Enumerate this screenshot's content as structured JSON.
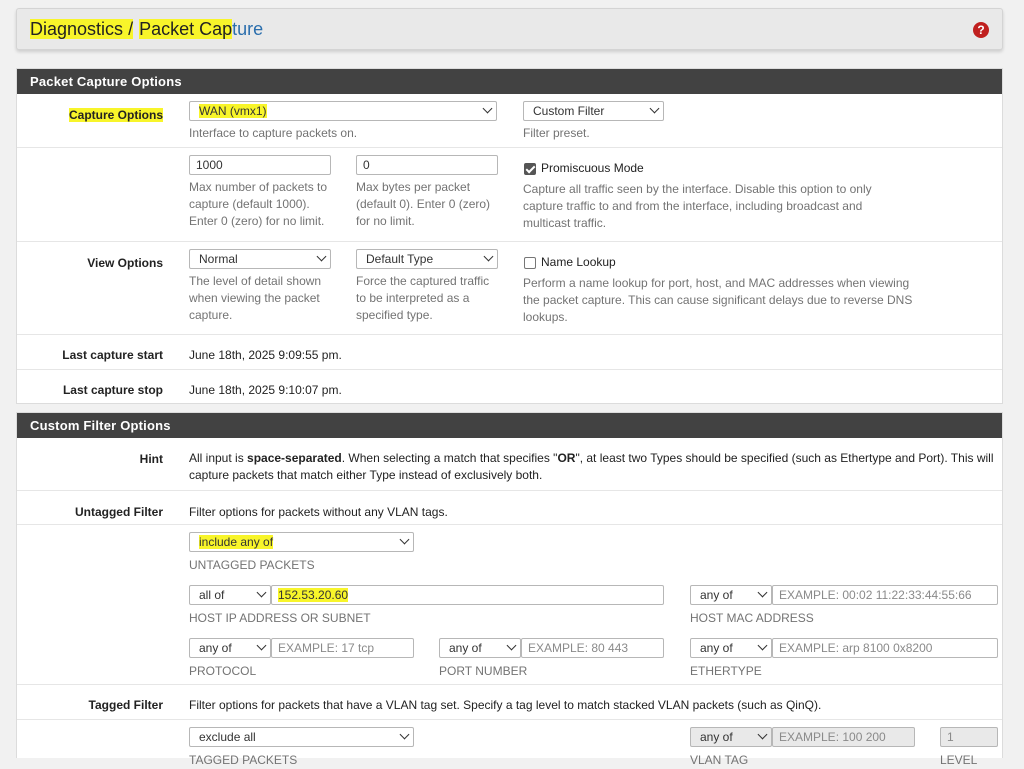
{
  "breadcrumb": {
    "section": "Diagnostics",
    "separator": "/",
    "page_a": "Packet Cap",
    "page_b": "ture"
  },
  "help_icon": "question-circle-icon",
  "colors": {
    "panel_header": "#424242",
    "highlight": "#f8f52a",
    "help_red": "#c0201f",
    "link_blue": "#2a6ead"
  },
  "capture_panel": {
    "title": "Packet Capture Options",
    "capture_options": {
      "label": "Capture Options",
      "interface": "WAN (vmx1)",
      "interface_help": "Interface to capture packets on.",
      "filter": "Custom Filter",
      "filter_help": "Filter preset."
    },
    "limits": {
      "packets": "1000",
      "packets_help": "Max number of packets to capture (default 1000). Enter 0 (zero) for no limit.",
      "bytes": "0",
      "bytes_help": "Max bytes per packet (default 0). Enter 0 (zero) for no limit.",
      "promiscuous_label": "Promiscuous Mode",
      "promiscuous_checked": true,
      "promiscuous_help": "Capture all traffic seen by the interface. Disable this option to only capture traffic to and from the interface, including broadcast and multicast traffic."
    },
    "view_options": {
      "label": "View Options",
      "detail": "Normal",
      "detail_help": "The level of detail shown when viewing the packet capture.",
      "type": "Default Type",
      "type_help": "Force the captured traffic to be interpreted as a specified type.",
      "name_lookup_label": "Name Lookup",
      "name_lookup_checked": false,
      "name_lookup_help": "Perform a name lookup for port, host, and MAC addresses when viewing the packet capture. This can cause significant delays due to reverse DNS lookups."
    },
    "last_start": {
      "label": "Last capture start",
      "value": "June 18th, 2025 9:09:55 pm."
    },
    "last_stop": {
      "label": "Last capture stop",
      "value": "June 18th, 2025 9:10:07 pm."
    }
  },
  "filter_panel": {
    "title": "Custom Filter Options",
    "hint": {
      "label": "Hint",
      "text_1": "All input is ",
      "bold_1": "space-separated",
      "text_2": ". When selecting a match that specifies \"",
      "bold_2": "OR",
      "text_3": "\", at least two Types should be specified (such as Ethertype and Port). This will capture packets that match either Type instead of exclusively both."
    },
    "untagged": {
      "label": "Untagged Filter",
      "description": "Filter options for packets without any VLAN tags.",
      "packets_select": "include any of",
      "packets_label": "UNTAGGED PACKETS",
      "host_select": "all of",
      "host_value": "152.53.20.60",
      "host_label": "HOST IP ADDRESS OR SUBNET",
      "mac_select": "any of",
      "mac_placeholder": "EXAMPLE: 00:02 11:22:33:44:55:66",
      "mac_label": "HOST MAC ADDRESS",
      "proto_select": "any of",
      "proto_placeholder": "EXAMPLE: 17 tcp",
      "proto_label": "PROTOCOL",
      "port_select": "any of",
      "port_placeholder": "EXAMPLE: 80 443",
      "port_label": "PORT NUMBER",
      "ether_select": "any of",
      "ether_placeholder": "EXAMPLE: arp 8100 0x8200",
      "ether_label": "ETHERTYPE"
    },
    "tagged": {
      "label": "Tagged Filter",
      "description": "Filter options for packets that have a VLAN tag set. Specify a tag level to match stacked VLAN packets (such as QinQ).",
      "packets_select": "exclude all",
      "packets_label": "TAGGED PACKETS",
      "vlan_select": "any of",
      "vlan_placeholder": "EXAMPLE: 100 200",
      "vlan_label": "VLAN TAG",
      "level_value": "1",
      "level_label": "LEVEL"
    }
  }
}
